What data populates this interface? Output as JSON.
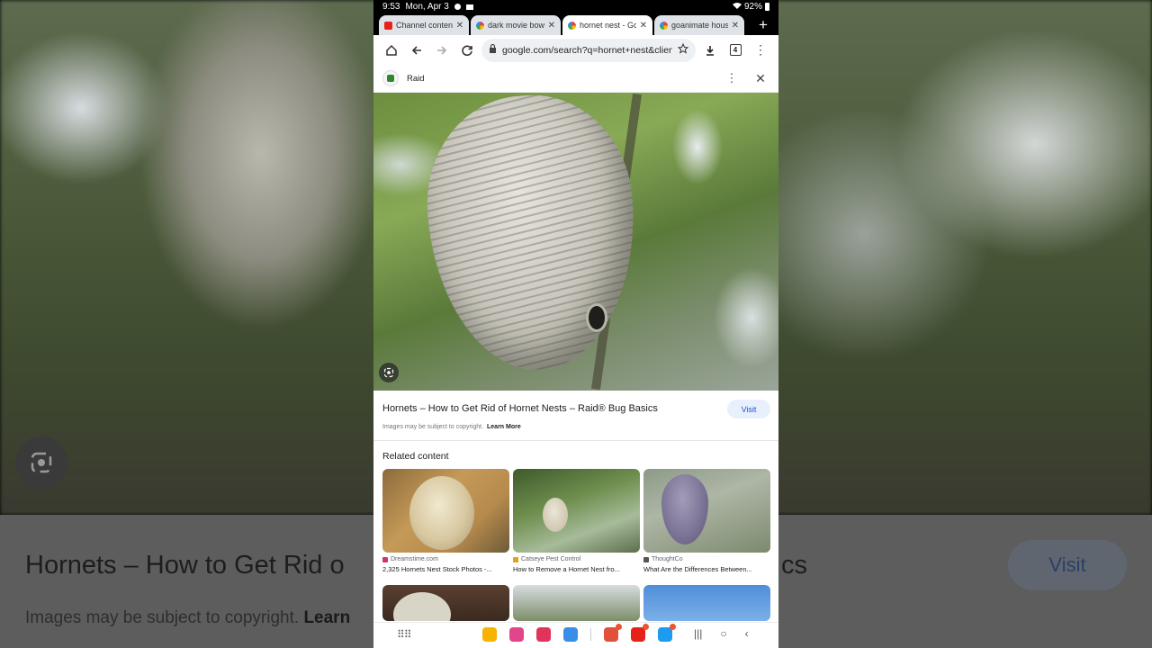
{
  "status_bar": {
    "time": "9:53",
    "date": "Mon, Apr 3",
    "battery": "92%"
  },
  "tabs": [
    {
      "label": "Channel content",
      "favicon": "youtube-icon",
      "active": false
    },
    {
      "label": "dark movie bows",
      "favicon": "google-icon",
      "active": false
    },
    {
      "label": "hornet nest - Goo",
      "favicon": "google-icon",
      "active": true
    },
    {
      "label": "goanimate house",
      "favicon": "google-icon",
      "active": false
    }
  ],
  "toolbar": {
    "url": "google.com/search?q=hornet+nest&client=t",
    "tab_count": "4"
  },
  "source": {
    "name": "Raid"
  },
  "result": {
    "title": "Hornets – How to Get Rid of Hornet Nests – Raid® Bug Basics",
    "copyright": "Images may be subject to copyright.",
    "learn_more": "Learn More",
    "visit_label": "Visit"
  },
  "related": {
    "heading": "Related content",
    "items": [
      {
        "source": "Dreamstime.com",
        "title": "2,325 Hornets Nest Stock Photos -...",
        "source_color": "#d6336c"
      },
      {
        "source": "Catseye Pest Control",
        "title": "How to Remove a Hornet Nest fro...",
        "source_color": "#e0a21a"
      },
      {
        "source": "ThoughtCo",
        "title": "What Are the Differences Between...",
        "source_color": "#555555"
      }
    ]
  },
  "background": {
    "title_left": "Hornets – How to Get Rid o",
    "title_right": "cs",
    "copy": "Images may be subject to copyright.",
    "learn": "Learn",
    "visit": "Visit"
  },
  "dock_apps": [
    {
      "name": "files-app-icon",
      "color": "#f6b400",
      "badge": false
    },
    {
      "name": "flower-app-icon",
      "color": "#e2468a",
      "badge": false
    },
    {
      "name": "camera-app-icon",
      "color": "#e2345a",
      "badge": false
    },
    {
      "name": "chrome-app-icon",
      "color": "#3a8ee6",
      "badge": false
    },
    {
      "name": "email-app-icon",
      "color": "#e0503a",
      "badge": true
    },
    {
      "name": "youtube-app-icon",
      "color": "#e62117",
      "badge": true
    },
    {
      "name": "twitter-app-icon",
      "color": "#1d9bf0",
      "badge": true
    }
  ]
}
